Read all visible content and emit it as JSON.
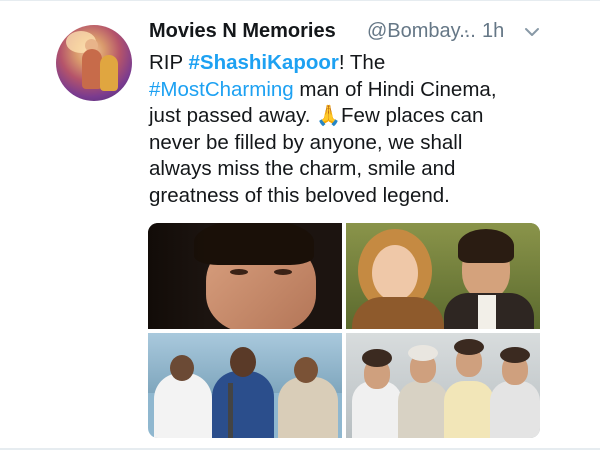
{
  "tweet": {
    "display_name": "Movies N Memories",
    "handle": "@Bombay...",
    "separator": "·",
    "time": "1h",
    "text_lines": [
      {
        "pre": "RIP ",
        "tag": "#ShashiKapoor",
        "post": "! The"
      },
      {
        "tag": "#MostCharming",
        "post": " man of Hindi Cinema,"
      },
      {
        "pre": "just passed away. ",
        "emoji": "🙏",
        "post": "Few places can"
      },
      {
        "text": "never be filled by anyone, we shall"
      },
      {
        "text": "always miss the charm, smile and"
      },
      {
        "text": "greatness of this beloved legend."
      }
    ]
  },
  "icons": {
    "menu": "chevron-down-icon",
    "emoji": "folded-hands-emoji"
  },
  "colors": {
    "link": "#1da1f2",
    "secondary_text": "#657786",
    "primary_text": "#14171a",
    "divider": "#e6ecf0"
  }
}
